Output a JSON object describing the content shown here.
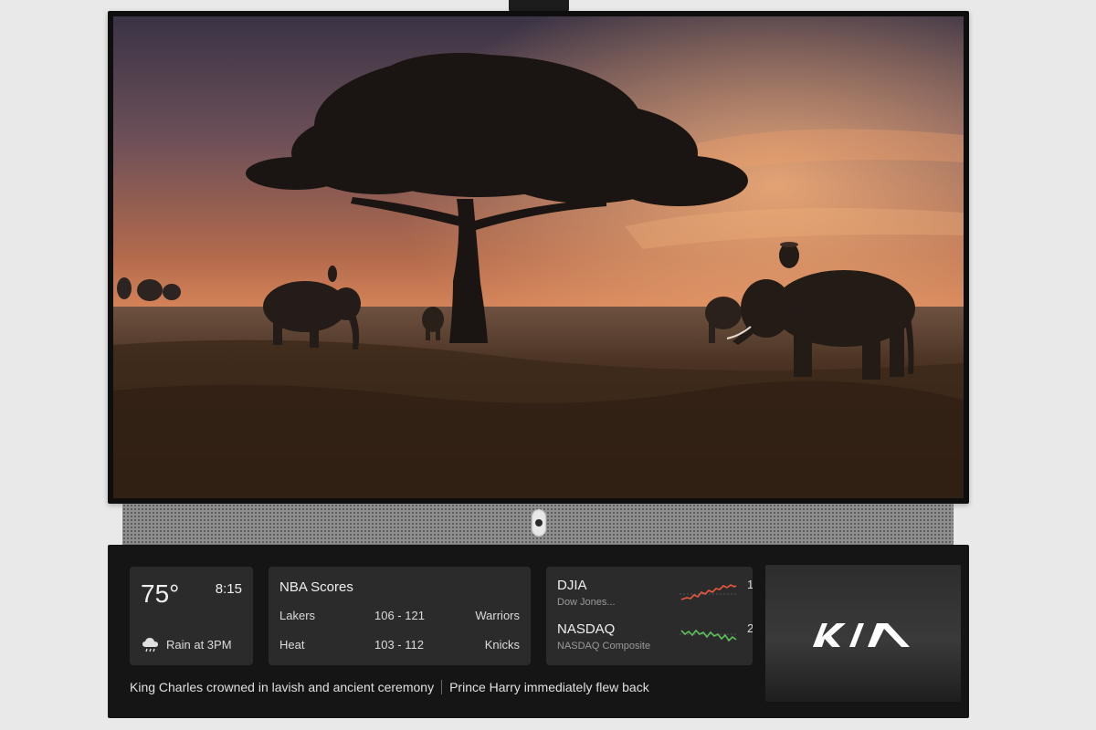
{
  "weather": {
    "temperature": "75°",
    "time": "8:15",
    "icon": "rain-cloud-icon",
    "forecast": "Rain at 3PM"
  },
  "nba": {
    "title": "NBA Scores",
    "games": [
      {
        "home": "Lakers",
        "score": "106 - 121",
        "away": "Warriors"
      },
      {
        "home": "Heat",
        "score": "103 - 112",
        "away": "Knicks"
      }
    ]
  },
  "stocks": [
    {
      "symbol": "DJIA",
      "name": "Dow Jones...",
      "trend": "down",
      "color": "#e8593b",
      "extra": "1"
    },
    {
      "symbol": "NASDAQ",
      "name": "NASDAQ Composite",
      "trend": "up",
      "color": "#5bc35b",
      "extra": "2"
    }
  ],
  "news": {
    "headlines": [
      "King Charles crowned in lavish and ancient ceremony",
      "Prince Harry immediately flew back"
    ]
  },
  "ad": {
    "brand": "KIA"
  },
  "colors": {
    "panel_bg": "#151515",
    "card_bg": "#2b2b2b",
    "stock_down": "#e8593b",
    "stock_up": "#5bc35b"
  }
}
